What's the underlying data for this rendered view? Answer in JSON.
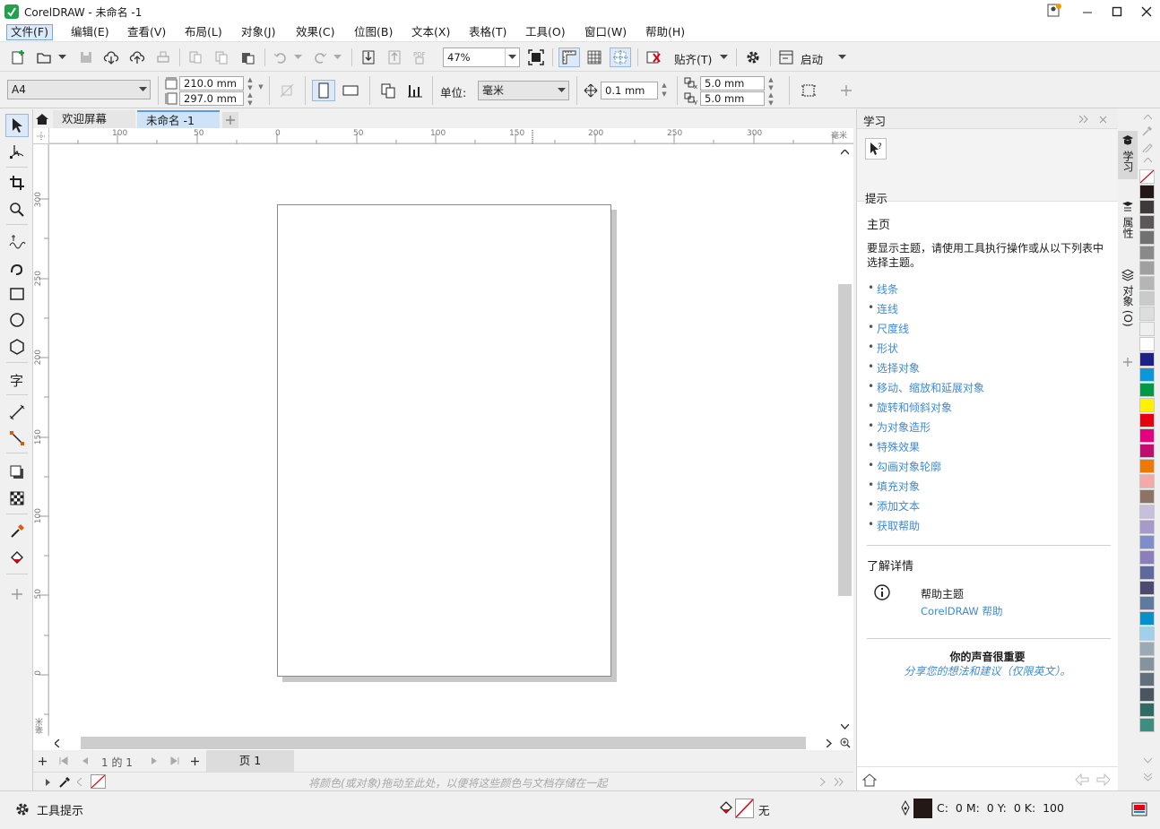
{
  "app": {
    "title": "CorelDRAW - 未命名 -1"
  },
  "menu": [
    "文件(F)",
    "编辑(E)",
    "查看(V)",
    "布局(L)",
    "对象(J)",
    "效果(C)",
    "位图(B)",
    "文本(X)",
    "表格(T)",
    "工具(O)",
    "窗口(W)",
    "帮助(H)"
  ],
  "toolbar": {
    "zoom": "47%",
    "snap_label": "贴齐(T)",
    "launch_label": "启动"
  },
  "property_bar": {
    "page_size": "A4",
    "width": "210.0 mm",
    "height": "297.0 mm",
    "units_label": "单位:",
    "units": "毫米",
    "nudge": "0.1 mm",
    "dup_x": "5.0 mm",
    "dup_y": "5.0 mm"
  },
  "tabs": {
    "welcome": "欢迎屏幕",
    "document": "未命名 -1"
  },
  "rulers": {
    "h_labels": [
      "100",
      "50",
      "0",
      "50",
      "100",
      "150",
      "200",
      "250",
      "300"
    ],
    "h_unit": "毫米",
    "v_labels": [
      "300",
      "250",
      "200",
      "150",
      "100",
      "50",
      "0"
    ],
    "v_unit": "毫米"
  },
  "pagebar": {
    "position": "1 的 1",
    "page_tab": "页 1"
  },
  "palette_bar": {
    "hint": "将颜色(或对象)拖动至此处，以便将这些颜色与文档存储在一起"
  },
  "docker": {
    "title": "学习",
    "hint_label": "提示",
    "section_title": "主页",
    "description": "要显示主题，请使用工具执行操作或从以下列表中选择主题。",
    "topics": [
      "线条",
      "连线",
      "尺度线",
      "形状",
      "选择对象",
      "移动、缩放和延展对象",
      "旋转和倾斜对象",
      "为对象造形",
      "特殊效果",
      "勾画对象轮廓",
      "填充对象",
      "添加文本",
      "获取帮助"
    ],
    "learn_more_title": "了解详情",
    "help_topic_title": "帮助主题",
    "help_link": "CorelDRAW 帮助",
    "feedback_title": "你的声音很重要",
    "feedback_link": "分享您的想法和建议（仅限英文）。",
    "tabs": [
      "学习",
      "属性",
      "对象 (O)"
    ]
  },
  "palette_colors": [
    "#231815",
    "#3e3a39",
    "#595757",
    "#727171",
    "#898989",
    "#9fa0a0",
    "#b5b5b6",
    "#c9caca",
    "#dcdddd",
    "#efefef",
    "#ffffff",
    "#1d2088",
    "#0b96dd",
    "#009944",
    "#fff100",
    "#e60012",
    "#e4007f",
    "#c30d6e",
    "#ee7800",
    "#f3a9a5",
    "#8c7365",
    "#c6c0dc",
    "#a59aca",
    "#7f8ecb",
    "#8a7fb8",
    "#5e6a9b",
    "#4c4a6e",
    "#5d7b9f",
    "#0a8fce",
    "#9fd1ef",
    "#9aabb7",
    "#85939f",
    "#60707c",
    "#49555f",
    "#2f6b62",
    "#3c8f7e"
  ],
  "status": {
    "hint": "工具提示",
    "fill": "无",
    "cmyk": "C:  0 M:  0 Y:  0 K:  100"
  }
}
